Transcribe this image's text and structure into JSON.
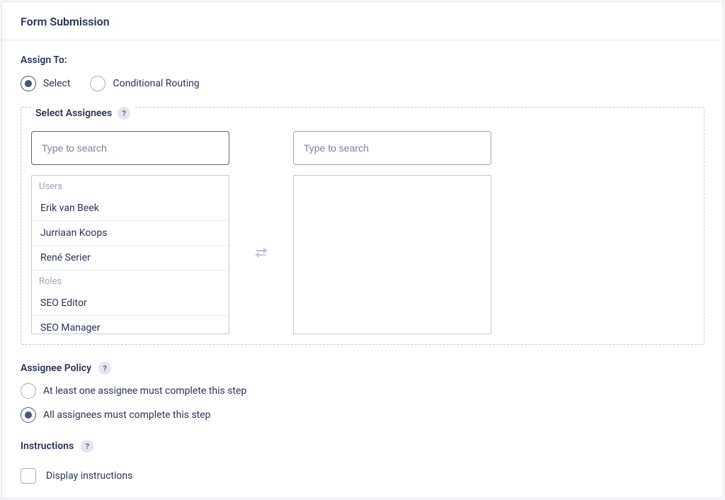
{
  "header": {
    "title": "Form Submission"
  },
  "assign_to": {
    "label": "Assign To:",
    "options": {
      "select": "Select",
      "conditional": "Conditional Routing"
    }
  },
  "select_assignees": {
    "legend": "Select Assignees",
    "help": "?",
    "search_placeholder_left": "Type to search",
    "search_placeholder_right": "Type to search",
    "groups": {
      "users_label": "Users",
      "users": [
        "Erik van Beek",
        "Jurriaan Koops",
        "René Serier"
      ],
      "roles_label": "Roles",
      "roles": [
        "SEO Editor",
        "SEO Manager"
      ]
    }
  },
  "assignee_policy": {
    "label": "Assignee Policy",
    "help": "?",
    "options": {
      "at_least_one": "At least one assignee must complete this step",
      "all": "All assignees must complete this step"
    }
  },
  "instructions": {
    "label": "Instructions",
    "help": "?",
    "checkbox_label": "Display instructions"
  }
}
